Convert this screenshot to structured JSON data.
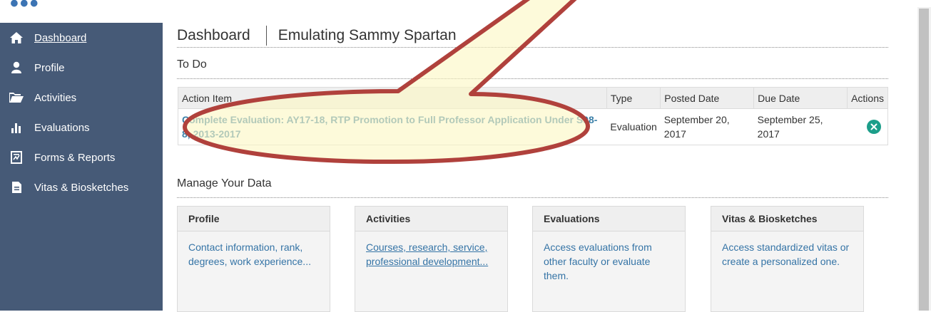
{
  "sidebar": {
    "items": [
      {
        "label": "Dashboard",
        "icon": "home-icon"
      },
      {
        "label": "Profile",
        "icon": "user-icon"
      },
      {
        "label": "Activities",
        "icon": "folder-open-icon"
      },
      {
        "label": "Evaluations",
        "icon": "bar-chart-icon"
      },
      {
        "label": "Forms & Reports",
        "icon": "report-icon"
      },
      {
        "label": "Vitas & Biosketches",
        "icon": "document-icon"
      }
    ]
  },
  "header": {
    "title": "Dashboard",
    "subtitle": "Emulating Sammy Spartan"
  },
  "todo": {
    "heading": "To Do",
    "columns": [
      "Action Item",
      "Type",
      "Posted Date",
      "Due Date",
      "Actions"
    ],
    "rows": [
      {
        "action_item": "Complete Evaluation: AY17-18, RTP Promotion to Full Professor Application Under S98-8, 2013-2017",
        "type": "Evaluation",
        "posted_date": "September 20, 2017",
        "due_date": "September 25, 2017"
      }
    ]
  },
  "manage": {
    "heading": "Manage Your Data",
    "cards": [
      {
        "title": "Profile",
        "description": "Contact information, rank, degrees, work experience..."
      },
      {
        "title": "Activities",
        "description": "Courses, research, service, professional development..."
      },
      {
        "title": "Evaluations",
        "description": "Access evaluations from other faculty or evaluate them."
      },
      {
        "title": "Vitas & Biosketches",
        "description": "Access standardized vitas or create a personalized one."
      }
    ]
  },
  "colors": {
    "sidebar_bg": "#465a77",
    "link": "#3a7fa8",
    "remove_button": "#1c9e8a",
    "callout_fill": "#fbf7c6",
    "callout_stroke": "#b0413c"
  }
}
